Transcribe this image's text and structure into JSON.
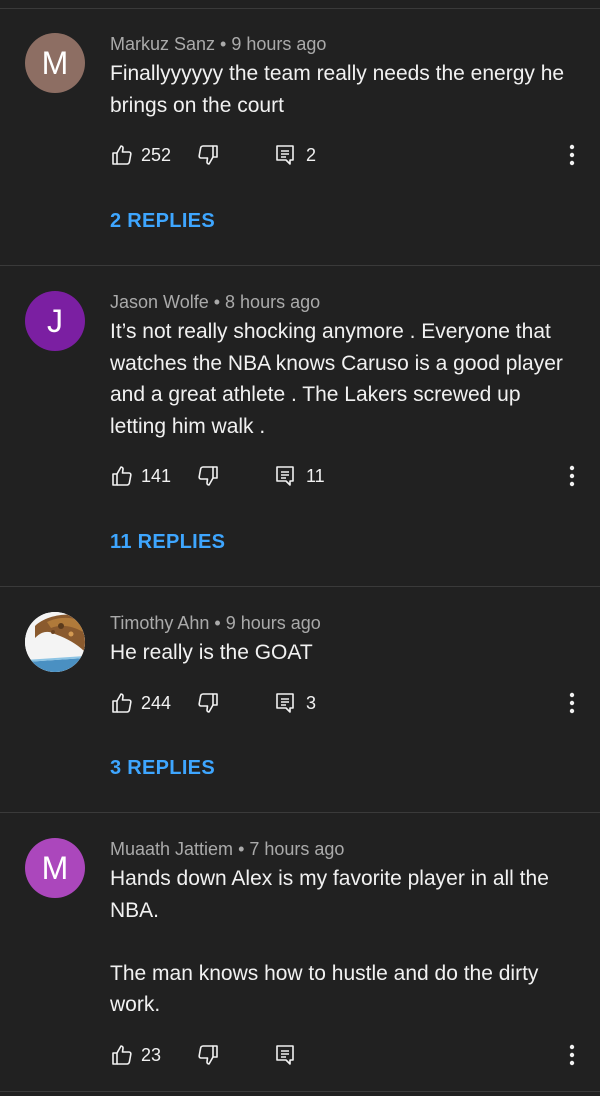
{
  "comments": [
    {
      "avatar_letter": "M",
      "avatar_color": "#8d6e63",
      "author": "Markuz Sanz",
      "time": "9 hours ago",
      "text": [
        "Finallyyyyyy the team really needs the energy he brings on the court"
      ],
      "likes": "252",
      "replies_count": "2",
      "replies_link": "2 REPLIES"
    },
    {
      "avatar_letter": "J",
      "avatar_color": "#7b1fa2",
      "author": "Jason Wolfe",
      "time": "8 hours ago",
      "text": [
        "It’s not really shocking anymore . Everyone that watches the NBA knows Caruso is a good player and a great athlete . The Lakers screwed up letting him walk ."
      ],
      "likes": "141",
      "replies_count": "11",
      "replies_link": "11 REPLIES"
    },
    {
      "avatar_letter": "",
      "avatar_color": "#ffffff",
      "author": "Timothy Ahn",
      "time": "9 hours ago",
      "text": [
        "He really is the GOAT"
      ],
      "likes": "244",
      "replies_count": "3",
      "replies_link": "3 REPLIES"
    },
    {
      "avatar_letter": "M",
      "avatar_color": "#ab47bc",
      "author": "Muaath Jattiem",
      "time": "7 hours ago",
      "text": [
        "Hands down Alex is my favorite player in all the NBA.",
        "The man knows how to hustle and do the dirty work."
      ],
      "likes": "23",
      "replies_count": "",
      "replies_link": ""
    }
  ],
  "icons": {
    "like": "thumbs-up-icon",
    "dislike": "thumbs-down-icon",
    "reply": "reply-icon",
    "more": "more-vert-icon"
  },
  "colors": {
    "background": "#212121",
    "link": "#3ea6ff",
    "meta": "#aaaaaa",
    "text": "#f1f1f1"
  }
}
